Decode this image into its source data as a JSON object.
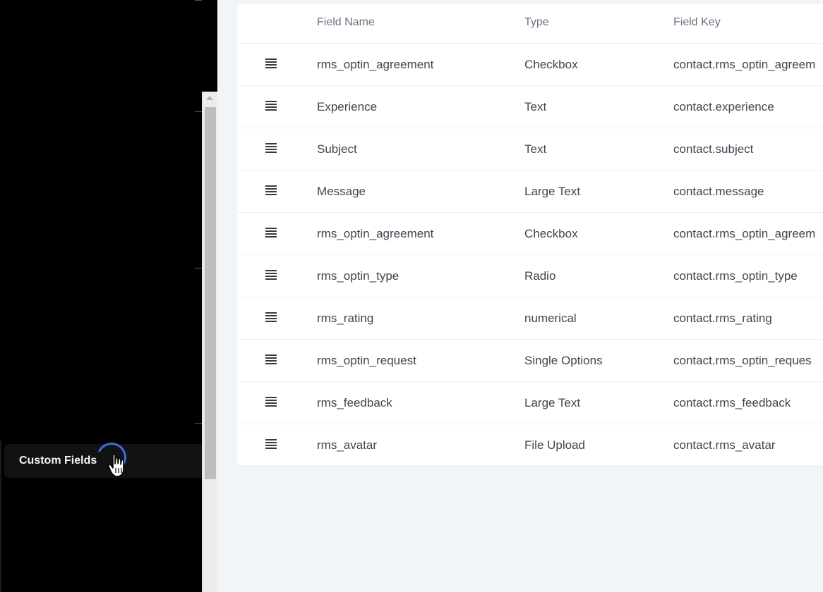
{
  "sidebar": {
    "active_item": "Custom Fields"
  },
  "table": {
    "headers": {
      "field_name": "Field Name",
      "type": "Type",
      "field_key": "Field Key"
    },
    "rows": [
      {
        "name": "rms_optin_agreement",
        "type": "Checkbox",
        "key": "contact.rms_optin_agreem"
      },
      {
        "name": "Experience",
        "type": "Text",
        "key": "contact.experience"
      },
      {
        "name": "Subject",
        "type": "Text",
        "key": "contact.subject"
      },
      {
        "name": "Message",
        "type": "Large Text",
        "key": "contact.message"
      },
      {
        "name": "rms_optin_agreement",
        "type": "Checkbox",
        "key": "contact.rms_optin_agreem"
      },
      {
        "name": "rms_optin_type",
        "type": "Radio",
        "key": "contact.rms_optin_type"
      },
      {
        "name": "rms_rating",
        "type": "numerical",
        "key": "contact.rms_rating"
      },
      {
        "name": "rms_optin_request",
        "type": "Single Options",
        "key": "contact.rms_optin_reques"
      },
      {
        "name": "rms_feedback",
        "type": "Large Text",
        "key": "contact.rms_feedback"
      },
      {
        "name": "rms_avatar",
        "type": "File Upload",
        "key": "contact.rms_avatar"
      }
    ]
  },
  "icons": {
    "drag_handle": "drag-handle-icon",
    "cursor": "hand-pointer-icon",
    "scroll_up": "scroll-up-arrow-icon"
  },
  "colors": {
    "accent": "#3d6fe0",
    "sidebar_bg": "#000000",
    "content_bg": "#f2f5f8"
  }
}
